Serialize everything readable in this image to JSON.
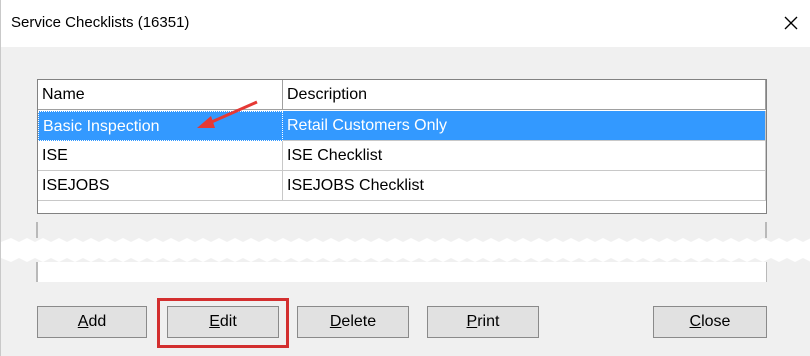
{
  "window": {
    "title": "Service Checklists (16351)"
  },
  "grid": {
    "columns": [
      "Name",
      "Description"
    ],
    "rows": [
      {
        "name": "Basic Inspection",
        "description": "Retail Customers Only",
        "selected": true
      },
      {
        "name": "ISE",
        "description": "ISE Checklist",
        "selected": false
      },
      {
        "name": "ISEJOBS",
        "description": "ISEJOBS Checklist",
        "selected": false
      }
    ]
  },
  "buttons": {
    "add": {
      "mnemonic": "A",
      "rest": "dd"
    },
    "edit": {
      "mnemonic": "E",
      "rest": "dit"
    },
    "delete": {
      "mnemonic": "D",
      "rest": "elete"
    },
    "print": {
      "mnemonic": "P",
      "rest": "rint"
    },
    "close": {
      "mnemonic": "C",
      "rest": "lose"
    }
  },
  "colors": {
    "selection": "#3399ff",
    "highlight_box": "#d32f2f",
    "annotation_arrow": "#e53935"
  },
  "icons": {
    "close": "close-icon",
    "arrow": "annotation-arrow-icon"
  }
}
